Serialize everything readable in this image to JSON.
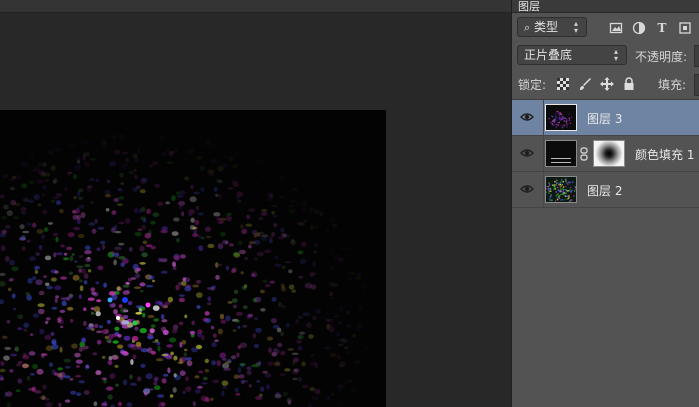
{
  "panel": {
    "tab_label": "图层",
    "filter_kind": "类型",
    "filter_icons": [
      "image-filter-icon",
      "adjustment-filter-icon",
      "type-filter-icon",
      "shape-filter-icon"
    ],
    "blend_mode": "正片叠底",
    "opacity_label": "不透明度:",
    "lock_label": "锁定:",
    "lock_icons": [
      "lock-transparent-pixels-icon",
      "lock-image-pixels-icon",
      "lock-position-icon",
      "lock-all-icon"
    ],
    "fill_label": "填充:"
  },
  "layers": [
    {
      "name": "图层 3",
      "selected": true,
      "visible": true
    },
    {
      "name": "颜色填充 1",
      "selected": false,
      "visible": true
    },
    {
      "name": "图层 2",
      "selected": false,
      "visible": true
    }
  ],
  "colors": {
    "panel_bg": "#535353",
    "workspace_bg": "#282828",
    "selected_layer": "#6f84a3",
    "canvas": "#030303"
  }
}
